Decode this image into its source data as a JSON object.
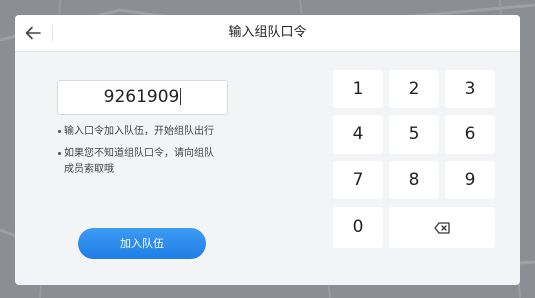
{
  "header": {
    "title": "输入组队口令"
  },
  "code_input": {
    "value": "9261909"
  },
  "hints": [
    {
      "lines": [
        "输入口令加入队伍，开始组队出行"
      ]
    },
    {
      "lines": [
        "如果您不知道组队口令，请向组队",
        "成员索取哦"
      ]
    }
  ],
  "join_button": {
    "label": "加入队伍"
  },
  "keypad": {
    "keys": [
      "1",
      "2",
      "3",
      "4",
      "5",
      "6",
      "7",
      "8",
      "9",
      "0"
    ]
  },
  "colors": {
    "accent": "#2a8cf0",
    "dialog_bg": "#f3f4f6",
    "key_bg": "#ffffff",
    "backdrop": "#8c8f93"
  },
  "icons": {
    "back": "arrow-left-icon",
    "delete": "backspace-icon"
  }
}
